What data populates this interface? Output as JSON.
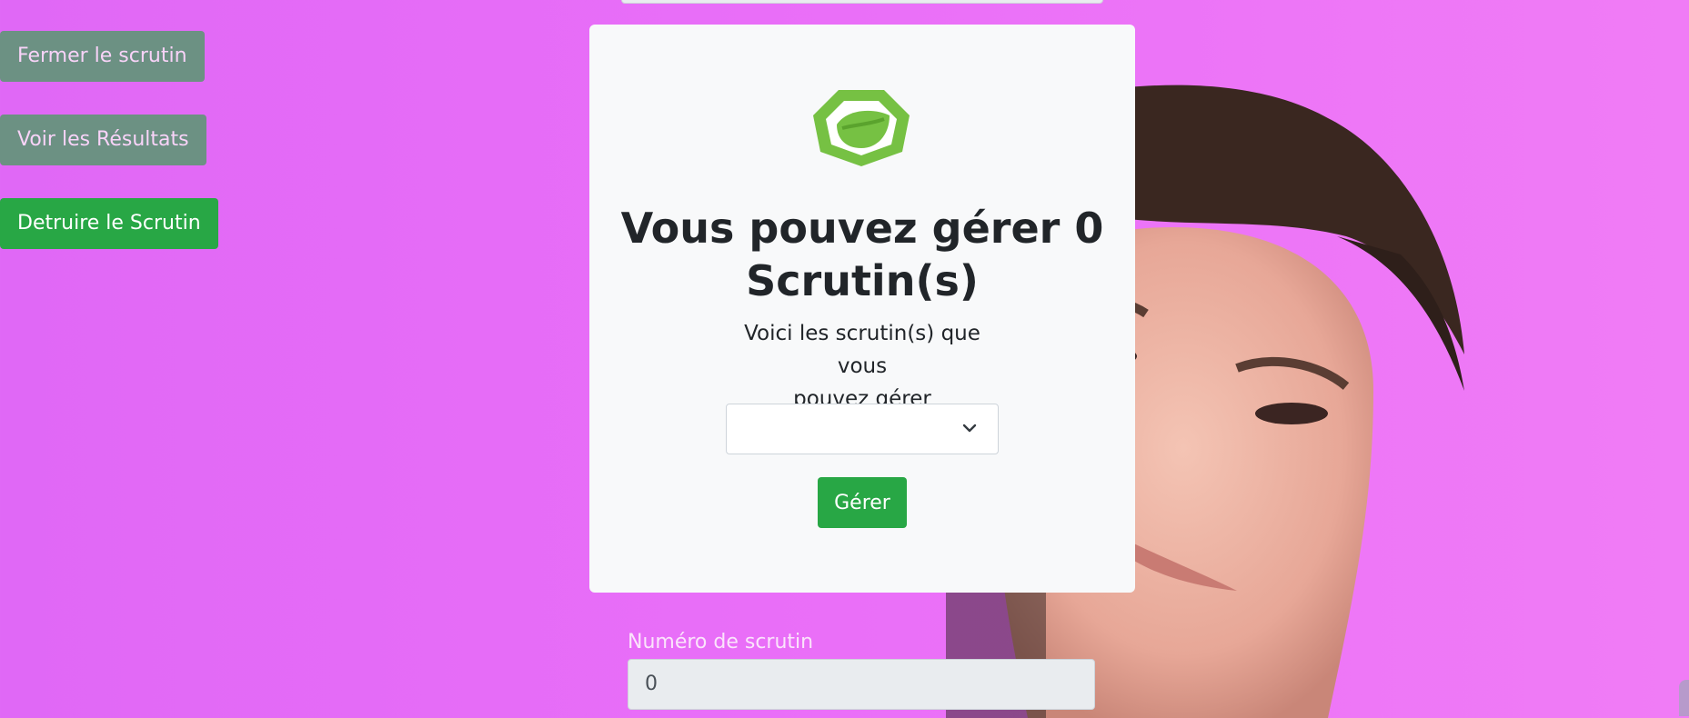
{
  "sidebar": {
    "close_label": "Fermer le scrutin",
    "results_label": "Voir les Résultats",
    "destroy_label": "Detruire le Scrutin"
  },
  "card": {
    "title_line1": "Vous pouvez gérer 0",
    "title_line2": "Scrutin(s)",
    "subtitle_line1": "Voici les scrutin(s) que vous",
    "subtitle_line2": "pouvez gérer",
    "select_value": "",
    "manage_label": "Gérer"
  },
  "form": {
    "number_label": "Numéro de scrutin",
    "number_value": "0"
  },
  "colors": {
    "background": "#e86cf7",
    "success": "#28a745",
    "muted_button": "#6c9183",
    "card": "#f8f9fa",
    "logo_green": "#76c143"
  },
  "icons": {
    "logo": "spring-leaf-logo-icon",
    "select_caret": "chevron-down-icon",
    "background_photo": "person-photo"
  }
}
